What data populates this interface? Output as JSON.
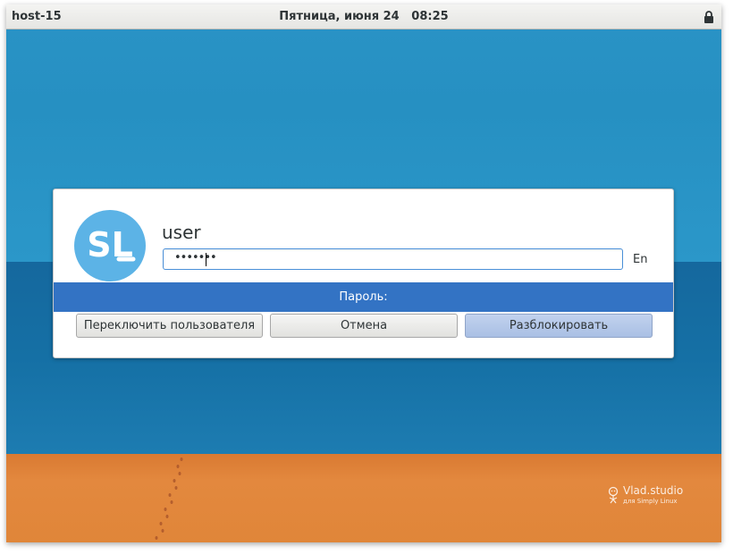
{
  "topbar": {
    "hostname": "host-15",
    "datetime": "Пятница, июня 24   08:25",
    "lock_icon": "lock-icon"
  },
  "dialog": {
    "avatar_text": "SL",
    "username": "user",
    "password_value": "•••••••",
    "language": "En",
    "prompt": "Пароль:",
    "buttons": {
      "switch_user": "Переключить пользователя",
      "cancel": "Отмена",
      "unlock": "Разблокировать"
    }
  },
  "watermark": {
    "title": "Vlad.studio",
    "subtitle": "для Simply Linux"
  },
  "colors": {
    "accent": "#3373c4",
    "avatar": "#5cb3e6",
    "sky": "#2690c2",
    "sea": "#1570a5",
    "sand": "#e3883e"
  }
}
